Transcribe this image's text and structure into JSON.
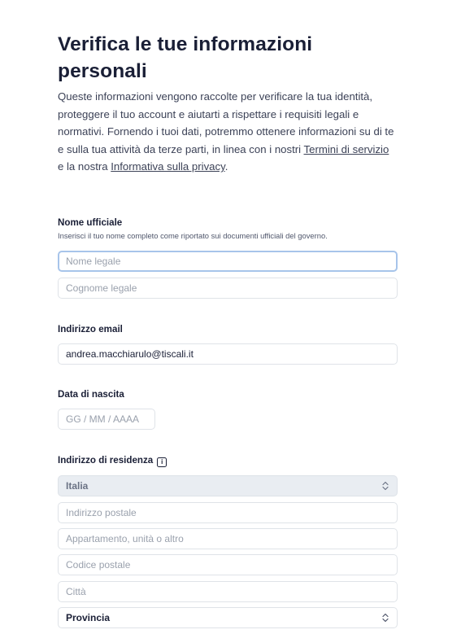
{
  "header": {
    "title": "Verifica le tue informazioni personali",
    "intro_text": "Queste informazioni vengono raccolte per verificare la tua identità, proteggere il tuo account e aiutarti a rispettare i requisiti legali e normativi. Fornendo i tuoi dati, potremmo ottenere informazioni su di te e sulla tua attività da terze parti, in linea con i nostri ",
    "terms_link": "Termini di servizio",
    "connector": " e la nostra ",
    "privacy_link": "Informativa sulla privacy",
    "intro_end": "."
  },
  "name_section": {
    "title": "Nome ufficiale",
    "hint": "Inserisci il tuo nome completo come riportato sui documenti ufficiali del governo.",
    "first_placeholder": "Nome legale",
    "last_placeholder": "Cognome legale"
  },
  "email_section": {
    "title": "Indirizzo email",
    "value": "andrea.macchiarulo@tiscali.it"
  },
  "dob_section": {
    "title": "Data di nascita",
    "placeholder": "GG / MM / AAAA"
  },
  "address_section": {
    "title": "Indirizzo di residenza",
    "info_icon": "info-icon",
    "country_value": "Italia",
    "street_placeholder": "Indirizzo postale",
    "apartment_placeholder": "Appartamento, unità o altro",
    "postal_placeholder": "Codice postale",
    "city_placeholder": "Città",
    "province_value": "Provincia"
  },
  "colors": {
    "text": "#1a1f36",
    "border": "#dfe3e8",
    "focus_border": "#a7c4ea",
    "disabled_bg": "#e9edf2"
  }
}
